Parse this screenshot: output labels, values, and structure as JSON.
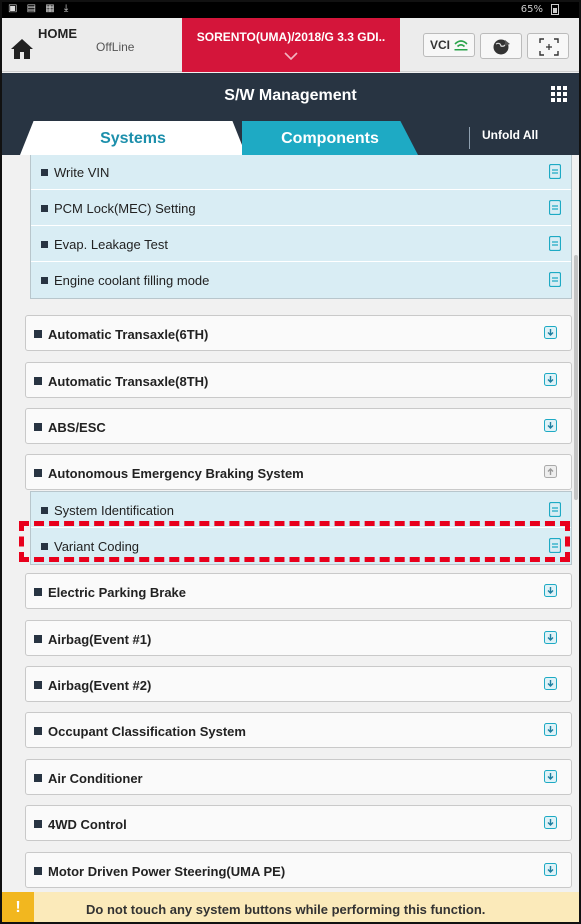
{
  "status_bar": {
    "battery": "65%"
  },
  "header": {
    "home_label": "HOME",
    "offline_label": "OffLine",
    "vehicle": "SORENTO(UMA)/2018/G 3.3 GDI..",
    "vci_label": "VCI"
  },
  "title_bar": {
    "title": "S/W Management"
  },
  "tabs": {
    "systems": "Systems",
    "components": "Components",
    "unfold_all": "Unfold All"
  },
  "engine_subitems": [
    "Write VIN",
    "PCM Lock(MEC) Setting",
    "Evap. Leakage Test",
    "Engine coolant filling mode"
  ],
  "systems": {
    "at6": "Automatic Transaxle(6TH)",
    "at8": "Automatic Transaxle(8TH)",
    "abs": "ABS/ESC",
    "aeb": "Autonomous Emergency Braking System",
    "epb": "Electric Parking Brake",
    "airbag1": "Airbag(Event #1)",
    "airbag2": "Airbag(Event #2)",
    "ocs": "Occupant Classification System",
    "ac": "Air Conditioner",
    "awd": "4WD Control",
    "mdps": "Motor Driven Power Steering(UMA PE)"
  },
  "aeb_subitems": [
    "System Identification",
    "Variant Coding"
  ],
  "warning": {
    "text": "Do not touch any system buttons while performing this function."
  },
  "colors": {
    "brand_red": "#d4153a",
    "teal": "#1eaac4",
    "navy": "#283442",
    "highlight": "#e8001c",
    "warning": "#f2b71f"
  }
}
